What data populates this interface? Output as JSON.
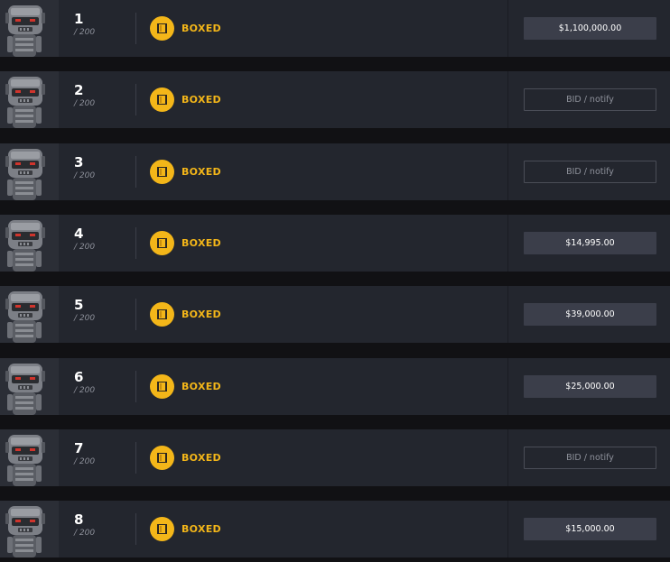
{
  "listings": [
    {
      "serial": "1",
      "total": "/ 200",
      "status": "BOXED",
      "action": "$1,100,000.00",
      "action_type": "price"
    },
    {
      "serial": "2",
      "total": "/ 200",
      "status": "BOXED",
      "action": "BID / notify",
      "action_type": "bid"
    },
    {
      "serial": "3",
      "total": "/ 200",
      "status": "BOXED",
      "action": "BID / notify",
      "action_type": "bid"
    },
    {
      "serial": "4",
      "total": "/ 200",
      "status": "BOXED",
      "action": "$14,995.00",
      "action_type": "price"
    },
    {
      "serial": "5",
      "total": "/ 200",
      "status": "BOXED",
      "action": "$39,000.00",
      "action_type": "price"
    },
    {
      "serial": "6",
      "total": "/ 200",
      "status": "BOXED",
      "action": "$25,000.00",
      "action_type": "price"
    },
    {
      "serial": "7",
      "total": "/ 200",
      "status": "BOXED",
      "action": "BID / notify",
      "action_type": "bid"
    },
    {
      "serial": "8",
      "total": "/ 200",
      "status": "BOXED",
      "action": "$15,000.00",
      "action_type": "price"
    }
  ],
  "icons": {
    "thumbnail": "robot-figure-icon",
    "status": "box-icon"
  },
  "colors": {
    "row_bg": "#23262e",
    "accent": "#f3b619",
    "button_filled": "#3b3e4a"
  }
}
